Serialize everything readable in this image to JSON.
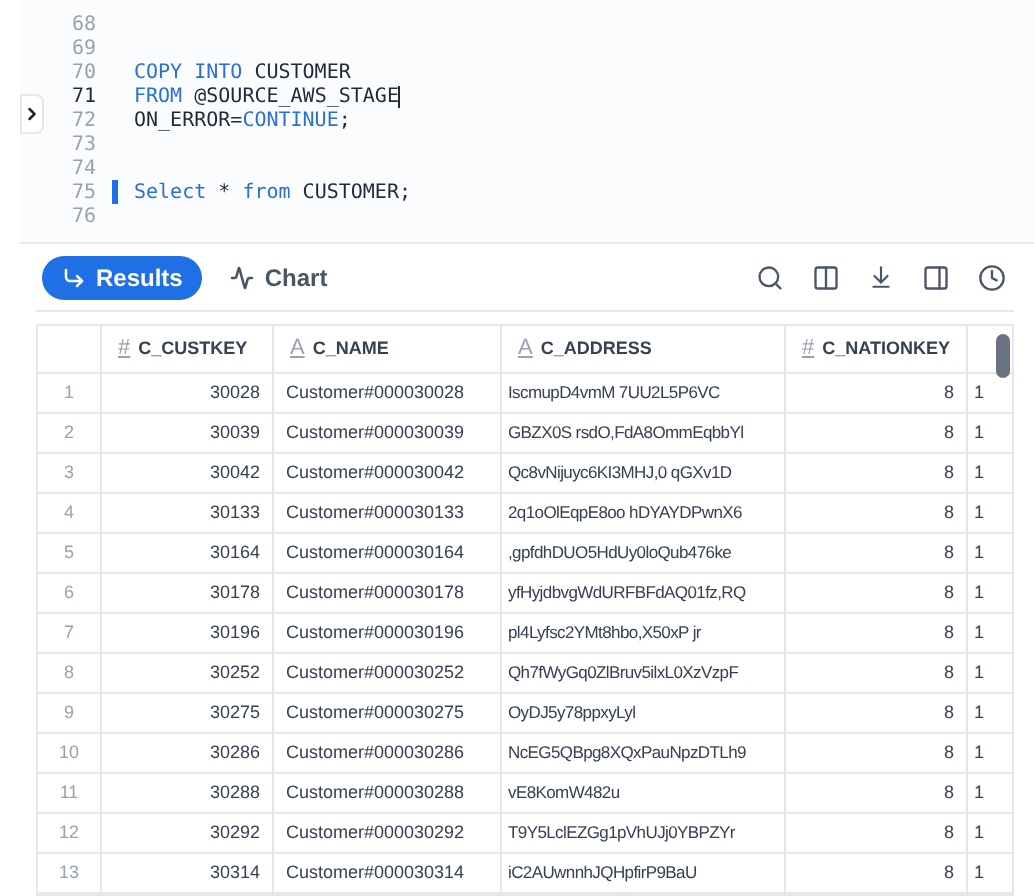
{
  "editor": {
    "lines": [
      {
        "number": "68",
        "active": false,
        "marked": false
      },
      {
        "number": "69",
        "active": false,
        "marked": false
      },
      {
        "number": "70",
        "active": false,
        "marked": false,
        "tokens": [
          {
            "text": "COPY INTO",
            "kind": "keyword"
          },
          {
            "text": " CUSTOMER",
            "kind": "plain"
          }
        ]
      },
      {
        "number": "71",
        "active": true,
        "marked": false,
        "tokens": [
          {
            "text": "FROM",
            "kind": "keyword"
          },
          {
            "text": " @SOURCE_AWS_STAGE",
            "kind": "plain"
          }
        ]
      },
      {
        "number": "72",
        "active": false,
        "marked": false,
        "tokens": [
          {
            "text": "ON_ERROR=",
            "kind": "plain"
          },
          {
            "text": "CONTINUE",
            "kind": "keyword"
          },
          {
            "text": ";",
            "kind": "plain"
          }
        ]
      },
      {
        "number": "73",
        "active": false,
        "marked": false
      },
      {
        "number": "74",
        "active": false,
        "marked": false
      },
      {
        "number": "75",
        "active": false,
        "marked": true,
        "tokens": [
          {
            "text": "Select",
            "kind": "keyword"
          },
          {
            "text": " * ",
            "kind": "plain"
          },
          {
            "text": "from",
            "kind": "keyword"
          },
          {
            "text": " CUSTOMER;",
            "kind": "plain"
          }
        ]
      },
      {
        "number": "76",
        "active": false,
        "marked": false
      }
    ]
  },
  "tabs": [
    {
      "label": "Results",
      "selected": true,
      "kind": "results"
    },
    {
      "label": "Chart",
      "selected": false,
      "kind": "chart"
    }
  ],
  "table": {
    "columns": [
      {
        "label": "C_CUSTKEY",
        "type_icon": "#"
      },
      {
        "label": "C_NAME",
        "type_icon": "A"
      },
      {
        "label": "C_ADDRESS",
        "type_icon": "A"
      },
      {
        "label": "C_NATIONKEY",
        "type_icon": "#"
      }
    ],
    "rows": [
      {
        "index": "1",
        "cells": [
          "30028",
          "Customer#000030028",
          "IscmupD4vmM 7UU2L5P6VC",
          "8",
          "1"
        ]
      },
      {
        "index": "2",
        "cells": [
          "30039",
          "Customer#000030039",
          "GBZX0S rsdO,FdA8OmmEqbbYl",
          "8",
          "1"
        ]
      },
      {
        "index": "3",
        "cells": [
          "30042",
          "Customer#000030042",
          "Qc8vNijuyc6KI3MHJ,0 qGXv1D",
          "8",
          "1"
        ]
      },
      {
        "index": "4",
        "cells": [
          "30133",
          "Customer#000030133",
          "2q1oOlEqpE8oo hDYAYDPwnX6",
          "8",
          "1"
        ]
      },
      {
        "index": "5",
        "cells": [
          "30164",
          "Customer#000030164",
          ",gpfdhDUO5HdUy0loQub476ke",
          "8",
          "1"
        ]
      },
      {
        "index": "6",
        "cells": [
          "30178",
          "Customer#000030178",
          "yfHyjdbvgWdURFBFdAQ01fz,RQ",
          "8",
          "1"
        ]
      },
      {
        "index": "7",
        "cells": [
          "30196",
          "Customer#000030196",
          "pl4Lyfsc2YMt8hbo,X50xP jr",
          "8",
          "1"
        ]
      },
      {
        "index": "8",
        "cells": [
          "30252",
          "Customer#000030252",
          "Qh7fWyGq0ZlBruv5ilxL0XzVzpF",
          "8",
          "1"
        ]
      },
      {
        "index": "9",
        "cells": [
          "30275",
          "Customer#000030275",
          "OyDJ5y78ppxyLyl",
          "8",
          "1"
        ]
      },
      {
        "index": "10",
        "cells": [
          "30286",
          "Customer#000030286",
          "NcEG5QBpg8XQxPauNpzDTLh9",
          "8",
          "1"
        ]
      },
      {
        "index": "11",
        "cells": [
          "30288",
          "Customer#000030288",
          "vE8KomW482u",
          "8",
          "1"
        ]
      },
      {
        "index": "12",
        "cells": [
          "30292",
          "Customer#000030292",
          "T9Y5LclEZGg1pVhUJj0YBPZYr",
          "8",
          "1"
        ]
      },
      {
        "index": "13",
        "cells": [
          "30314",
          "Customer#000030314",
          "iC2AUwnnhJQHpfirP9BaU",
          "8",
          "1"
        ]
      }
    ]
  }
}
